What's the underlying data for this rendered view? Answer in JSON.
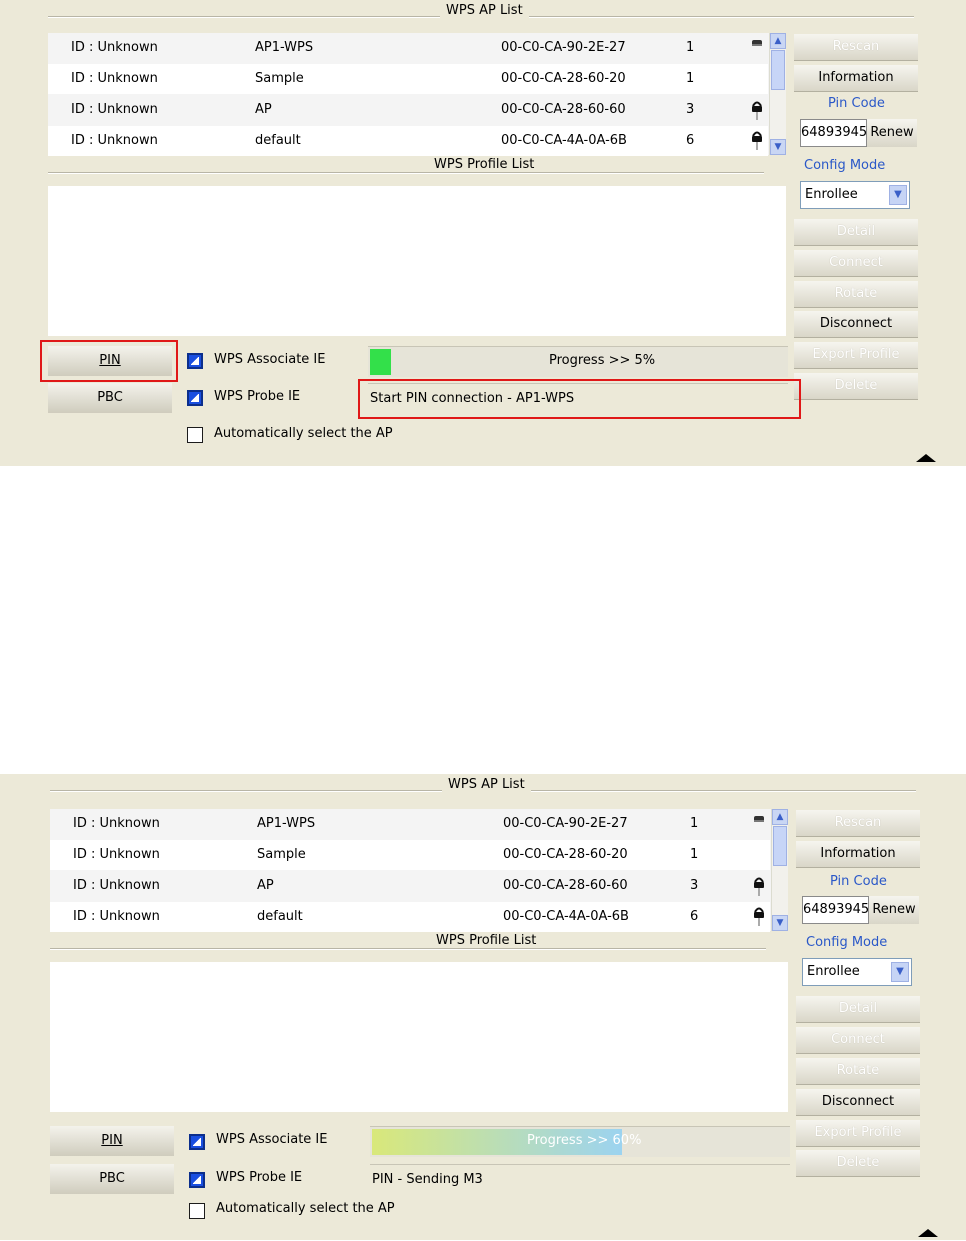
{
  "panels": [
    {
      "ap_list_title": "WPS AP List",
      "profile_list_title": "WPS Profile List",
      "aps": [
        {
          "id": "ID : Unknown",
          "ssid": "AP1-WPS",
          "bssid": "00-C0-CA-90-2E-27",
          "channel": "1",
          "lock": "unlocked"
        },
        {
          "id": "ID : Unknown",
          "ssid": "Sample",
          "bssid": "00-C0-CA-28-60-20",
          "channel": "1",
          "lock": "none"
        },
        {
          "id": "ID : Unknown",
          "ssid": "AP",
          "bssid": "00-C0-CA-28-60-60",
          "channel": "3",
          "lock": "locked"
        },
        {
          "id": "ID : Unknown",
          "ssid": "default",
          "bssid": "00-C0-CA-4A-0A-6B",
          "channel": "6",
          "lock": "locked"
        }
      ],
      "buttons": {
        "rescan": "Rescan",
        "information": "Information",
        "pin_code_label": "Pin Code",
        "pin_code_value": "64893945",
        "renew": "Renew",
        "config_mode_label": "Config Mode",
        "config_mode_value": "Enrollee",
        "detail": "Detail",
        "connect": "Connect",
        "rotate": "Rotate",
        "disconnect": "Disconnect",
        "export_profile": "Export Profile",
        "delete": "Delete",
        "pin": "PIN",
        "pbc": "PBC"
      },
      "options": {
        "associate_ie": "WPS Associate IE",
        "probe_ie": "WPS Probe IE",
        "auto_select": "Automatically select the AP"
      },
      "progress_text": "Progress >> 5%",
      "progress_value": 0.05,
      "status_text": "Start PIN connection - AP1-WPS",
      "colors": {
        "progress": "#33e04a",
        "highlight": "#e01818"
      }
    },
    {
      "ap_list_title": "WPS AP List",
      "profile_list_title": "WPS Profile List",
      "aps": [
        {
          "id": "ID : Unknown",
          "ssid": "AP1-WPS",
          "bssid": "00-C0-CA-90-2E-27",
          "channel": "1",
          "lock": "unlocked"
        },
        {
          "id": "ID : Unknown",
          "ssid": "Sample",
          "bssid": "00-C0-CA-28-60-20",
          "channel": "1",
          "lock": "none"
        },
        {
          "id": "ID : Unknown",
          "ssid": "AP",
          "bssid": "00-C0-CA-28-60-60",
          "channel": "3",
          "lock": "locked"
        },
        {
          "id": "ID : Unknown",
          "ssid": "default",
          "bssid": "00-C0-CA-4A-0A-6B",
          "channel": "6",
          "lock": "locked"
        }
      ],
      "buttons": {
        "rescan": "Rescan",
        "information": "Information",
        "pin_code_label": "Pin Code",
        "pin_code_value": "64893945",
        "renew": "Renew",
        "config_mode_label": "Config Mode",
        "config_mode_value": "Enrollee",
        "detail": "Detail",
        "connect": "Connect",
        "rotate": "Rotate",
        "disconnect": "Disconnect",
        "export_profile": "Export Profile",
        "delete": "Delete",
        "pin": "PIN",
        "pbc": "PBC"
      },
      "options": {
        "associate_ie": "WPS Associate IE",
        "probe_ie": "WPS Probe IE",
        "auto_select": "Automatically select the AP"
      },
      "progress_text": "Progress >> 60%",
      "progress_value": 0.6,
      "status_text": "PIN - Sending M3",
      "colors": {
        "progress_start": "#d9e87a",
        "progress_end": "#9cd3f0"
      }
    }
  ]
}
